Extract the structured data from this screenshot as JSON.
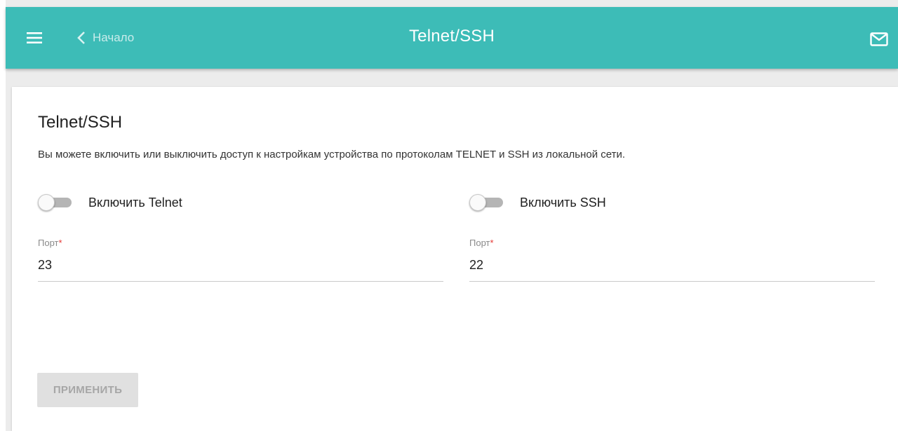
{
  "header": {
    "back_label": "Начало",
    "title": "Telnet/SSH",
    "menu_icon": "hamburger-menu-icon",
    "back_icon": "chevron-left-icon",
    "mail_icon": "envelope-icon",
    "background_color": "#3dbcb7"
  },
  "main": {
    "title": "Telnet/SSH",
    "description": "Вы можете включить или выключить доступ к настройкам устройства по протоколам TELNET и SSH из локальной сети.",
    "telnet": {
      "toggle_label": "Включить Telnet",
      "enabled": false,
      "port_label": "Порт",
      "port_required_mark": "*",
      "port_value": "23"
    },
    "ssh": {
      "toggle_label": "Включить SSH",
      "enabled": false,
      "port_label": "Порт",
      "port_required_mark": "*",
      "port_value": "22"
    },
    "apply_label": "ПРИМЕНИТЬ"
  }
}
